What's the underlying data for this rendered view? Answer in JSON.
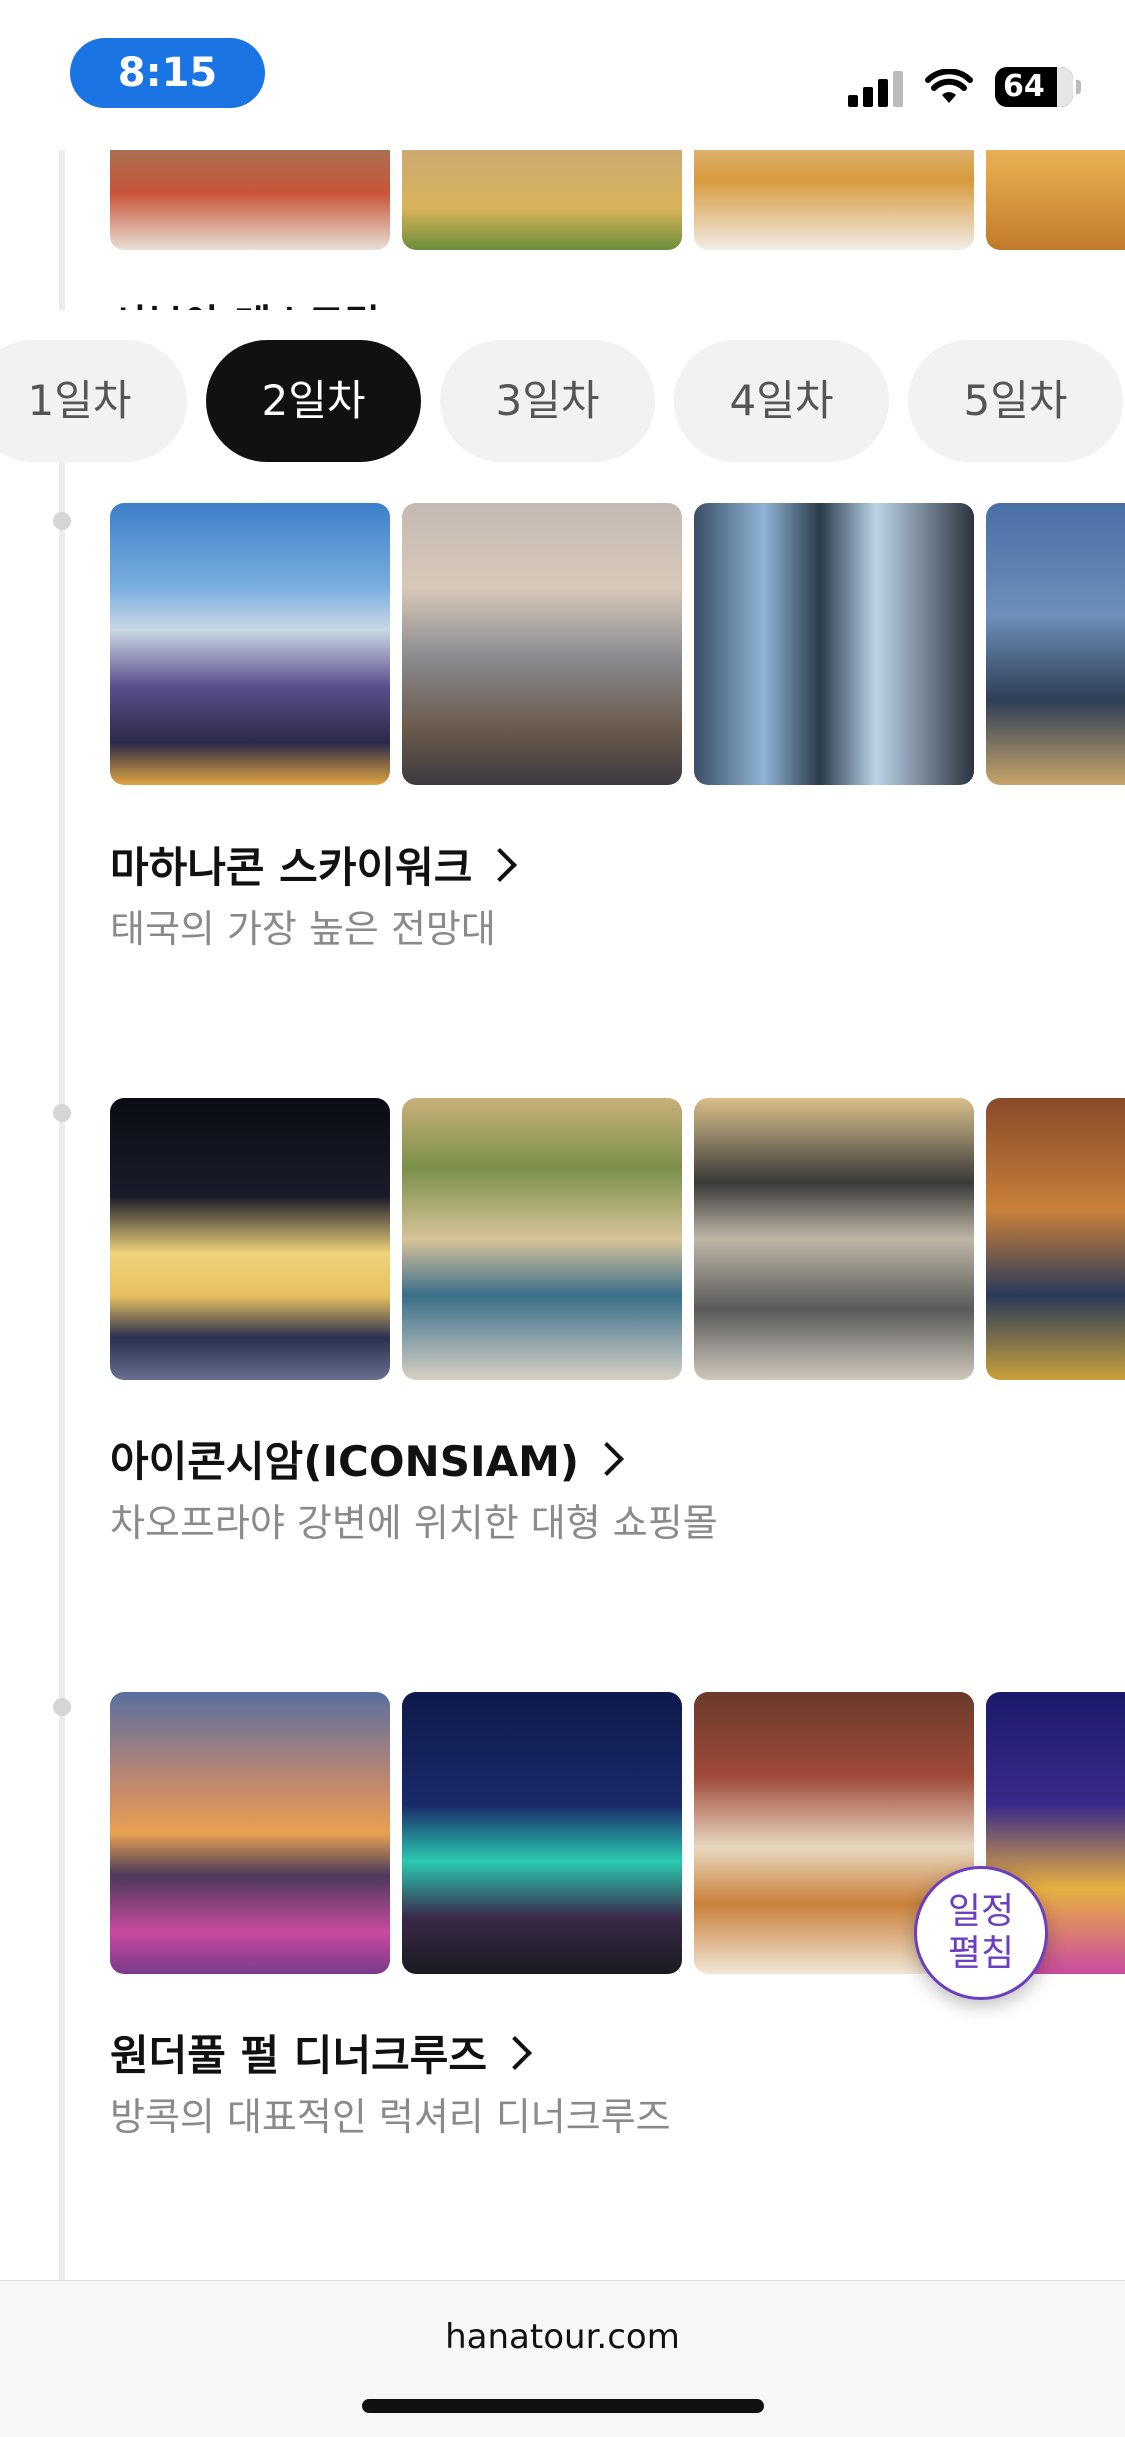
{
  "status_bar": {
    "time": "8:15",
    "battery": "64"
  },
  "previous_item": {
    "title_partial": "시부야 레스토랑 >"
  },
  "day_tabs": [
    "1일차",
    "2일차",
    "3일차",
    "4일차",
    "5일차"
  ],
  "selected_day": "2일차",
  "places": [
    {
      "title": "마하나콘 스카이워크",
      "description": "태국의 가장 높은 전망대"
    },
    {
      "title": "아이콘시암(ICONSIAM)",
      "description": "차오프라야 강변에 위치한 대형 쇼핑몰"
    },
    {
      "title": "원더풀 펄 디너크루즈",
      "description": "방콕의 대표적인 럭셔리 디너크루즈"
    }
  ],
  "floating_button": {
    "line1": "일정",
    "line2": "펼침"
  },
  "browser": {
    "url": "hanatour.com"
  },
  "colors": {
    "accent": "#1b74e4",
    "active_tab": "#111111",
    "float_button": "#6a3fc1"
  }
}
